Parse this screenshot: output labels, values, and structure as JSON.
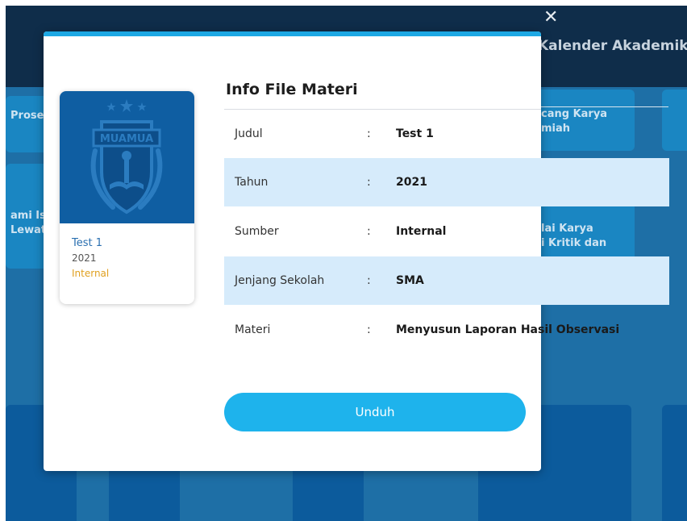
{
  "background": {
    "header_title": "Kalender Akademik",
    "close_icon": "close-icon",
    "cards": [
      {
        "line1": "Prose",
        "line2": ""
      },
      {
        "line1": "cang Karya",
        "line2": "miah"
      },
      {
        "line1": "ami Is",
        "line2": "Lewat"
      },
      {
        "line1": "lai Karya",
        "line2": "i Kritik dan"
      }
    ]
  },
  "modal": {
    "card": {
      "cover_text": "MUAMUA",
      "title": "Test 1",
      "year": "2021",
      "source": "Internal"
    },
    "info_title": "Info File Materi",
    "rows": [
      {
        "label": "Judul",
        "colon": ":",
        "value": "Test 1"
      },
      {
        "label": "Tahun",
        "colon": ":",
        "value": "2021"
      },
      {
        "label": "Sumber",
        "colon": ":",
        "value": "Internal"
      },
      {
        "label": "Jenjang Sekolah",
        "colon": ":",
        "value": "SMA"
      },
      {
        "label": "Materi",
        "colon": ":",
        "value": "Menyusun Laporan Hasil Observasi"
      }
    ],
    "download_label": "Unduh"
  },
  "colors": {
    "accent": "#1da8e4",
    "button": "#1eb3ec",
    "row_highlight": "#d6ebfb",
    "source_text": "#e0a020",
    "title_link": "#2a6fb0"
  }
}
